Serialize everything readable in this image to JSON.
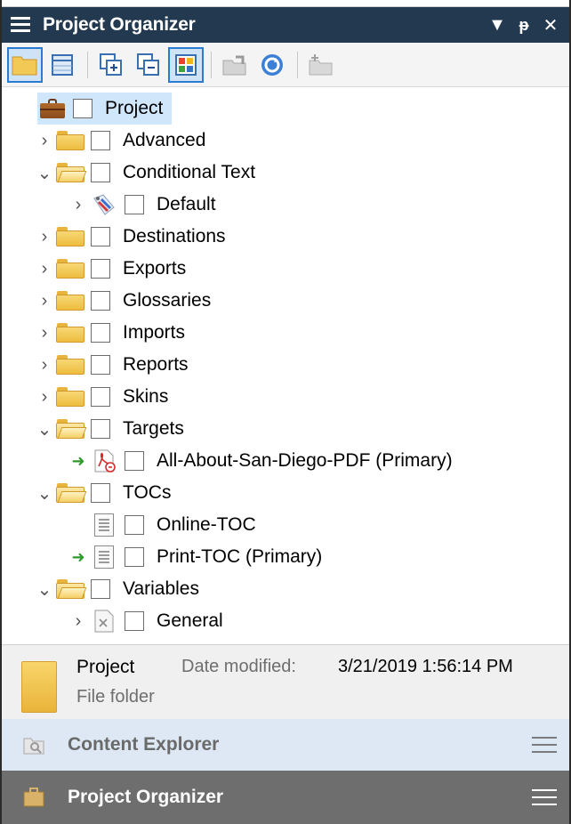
{
  "window": {
    "title": "Project Organizer",
    "controls": [
      "▼",
      "⊓",
      "✕"
    ]
  },
  "toolbar": {
    "buttons": [
      {
        "icon": "folder-view-icon",
        "active": true
      },
      {
        "icon": "grid-view-icon",
        "active": false
      },
      {
        "icon": "expand-all-icon",
        "active": false
      },
      {
        "icon": "collapse-all-icon",
        "active": false
      },
      {
        "icon": "show-colors-icon",
        "active": true
      },
      {
        "icon": "open-icon",
        "active": false
      },
      {
        "icon": "refresh-icon",
        "active": false
      },
      {
        "icon": "new-folder-icon",
        "active": false
      }
    ]
  },
  "tree": {
    "root": {
      "label": "Project"
    },
    "items": [
      {
        "label": "Advanced",
        "chevron": "›",
        "icon": "folder"
      },
      {
        "label": "Conditional Text",
        "chevron": "⌄",
        "icon": "folder-open"
      },
      {
        "label": "Default",
        "chevron": "›",
        "icon": "condition-tag"
      },
      {
        "label": "Destinations",
        "chevron": "›",
        "icon": "folder"
      },
      {
        "label": "Exports",
        "chevron": "›",
        "icon": "folder"
      },
      {
        "label": "Glossaries",
        "chevron": "›",
        "icon": "folder"
      },
      {
        "label": "Imports",
        "chevron": "›",
        "icon": "folder"
      },
      {
        "label": "Reports",
        "chevron": "›",
        "icon": "folder"
      },
      {
        "label": "Skins",
        "chevron": "›",
        "icon": "folder"
      },
      {
        "label": "Targets",
        "chevron": "⌄",
        "icon": "folder-open"
      },
      {
        "label": "All-About-San-Diego-PDF (Primary)",
        "chevron": "",
        "icon": "pdf-target",
        "primary_arrow": "➜"
      },
      {
        "label": "TOCs",
        "chevron": "⌄",
        "icon": "folder-open"
      },
      {
        "label": "Online-TOC",
        "chevron": "",
        "icon": "toc-doc"
      },
      {
        "label": "Print-TOC (Primary)",
        "chevron": "",
        "icon": "toc-doc",
        "primary_arrow": "➜"
      },
      {
        "label": "Variables",
        "chevron": "⌄",
        "icon": "folder-open"
      },
      {
        "label": "General",
        "chevron": "›",
        "icon": "variable-doc"
      }
    ]
  },
  "info": {
    "name": "Project",
    "date_modified_label": "Date modified:",
    "date_modified_value": "3/21/2019 1:56:14 PM",
    "type": "File folder"
  },
  "panels": {
    "content_explorer": "Content Explorer",
    "project_organizer": "Project Organizer"
  },
  "colors": {
    "titlebar": "#22394f",
    "selection": "#cfe6fb",
    "folder": "#f2c955",
    "active_panel": "#6e6e6e",
    "inactive_panel": "#dde8f4",
    "primary_arrow": "#2e9a2e"
  }
}
